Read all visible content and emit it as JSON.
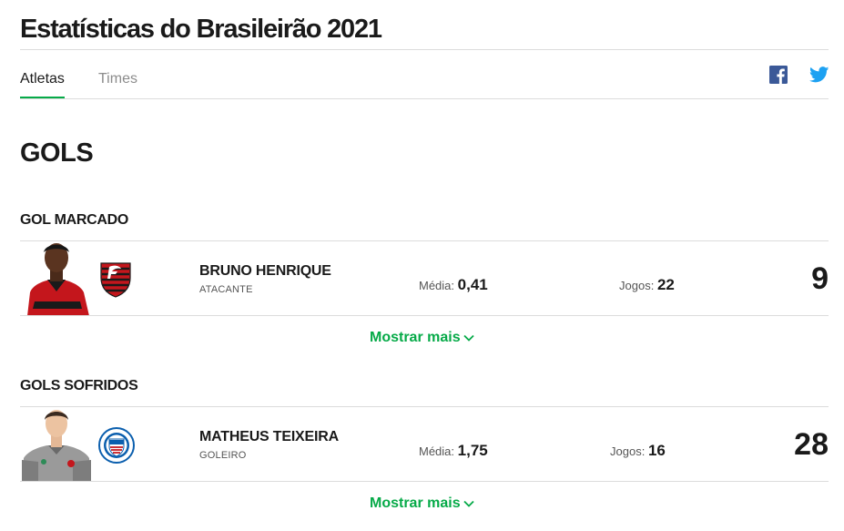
{
  "header": {
    "title": "Estatísticas do Brasileirão 2021"
  },
  "tabs": [
    {
      "label": "Atletas",
      "active": true
    },
    {
      "label": "Times",
      "active": false
    }
  ],
  "share": {
    "facebook": "facebook-icon",
    "twitter": "twitter-icon"
  },
  "section": {
    "title": "GOLS"
  },
  "categories": [
    {
      "title": "GOL MARCADO",
      "player": {
        "name": "BRUNO HENRIQUE",
        "position": "ATACANTE",
        "media_label": "Média:",
        "media_value": "0,41",
        "jogos_label": "Jogos:",
        "jogos_value": "22",
        "total": "9",
        "club": "flamengo-logo"
      },
      "more_label": "Mostrar mais"
    },
    {
      "title": "GOLS SOFRIDOS",
      "player": {
        "name": "MATHEUS TEIXEIRA",
        "position": "GOLEIRO",
        "media_label": "Média:",
        "media_value": "1,75",
        "jogos_label": "Jogos:",
        "jogos_value": "16",
        "total": "28",
        "club": "bahia-logo"
      },
      "more_label": "Mostrar mais"
    }
  ],
  "colors": {
    "accent": "#06aa48",
    "facebook": "#3b5998",
    "twitter": "#1da1f2",
    "flamengo_red": "#c4161c",
    "bahia_blue": "#0b5fae"
  }
}
